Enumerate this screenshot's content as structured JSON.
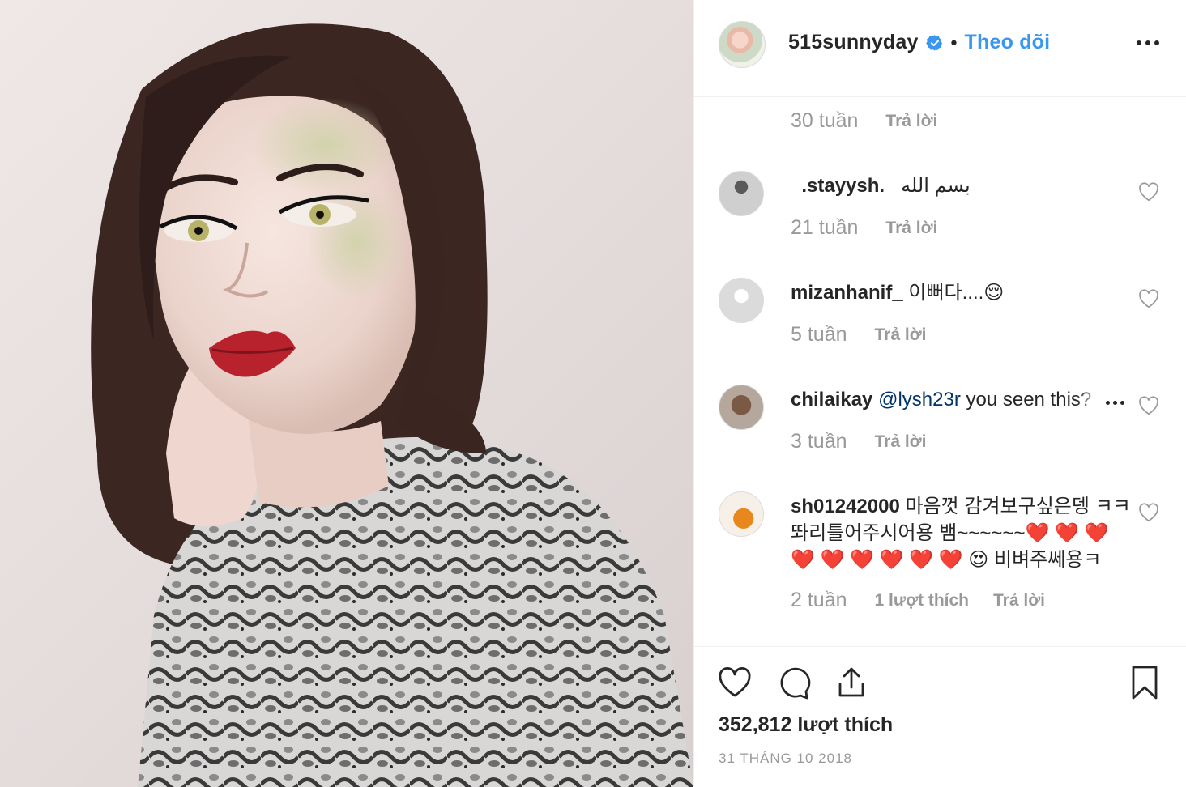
{
  "post": {
    "username": "515sunnyday",
    "separator": "•",
    "follow_label": "Theo dõi",
    "likes": "352,812 lượt thích",
    "date": "31 THÁNG 10 2018"
  },
  "comments_header": {
    "time": "30 tuần",
    "reply": "Trả lời"
  },
  "comments": [
    {
      "username": "_.stayysh._",
      "text": "بسم الله",
      "time": "21 tuần",
      "reply": "Trả lời"
    },
    {
      "username": "mizanhanif_",
      "text": "이뻐다....😌",
      "time": "5 tuần",
      "reply": "Trả lời"
    },
    {
      "username": "chilaikay",
      "mention": "@lysh23r",
      "text": "you seen this?",
      "time": "3 tuần",
      "reply": "Trả lời"
    },
    {
      "username": "sh01242000",
      "text": "마음껏 감겨보구싶은뎅 ㅋㅋ똬리틀어주시어용 뱀~~~~~~❤️ ❤️ ❤️ ❤️ ❤️ ❤️ ❤️ ❤️ ❤️ 😍 비벼주쎄용ㅋ",
      "time": "2 tuần",
      "likes": "1 lượt thích",
      "reply": "Trả lời"
    }
  ],
  "colors": {
    "link": "#3897f0",
    "muted": "#999999",
    "text": "#262626",
    "verified": "#3897f0"
  },
  "icons": [
    "verified-badge-icon",
    "more-options-icon",
    "heart-icon",
    "comment-icon",
    "share-icon",
    "bookmark-icon"
  ]
}
